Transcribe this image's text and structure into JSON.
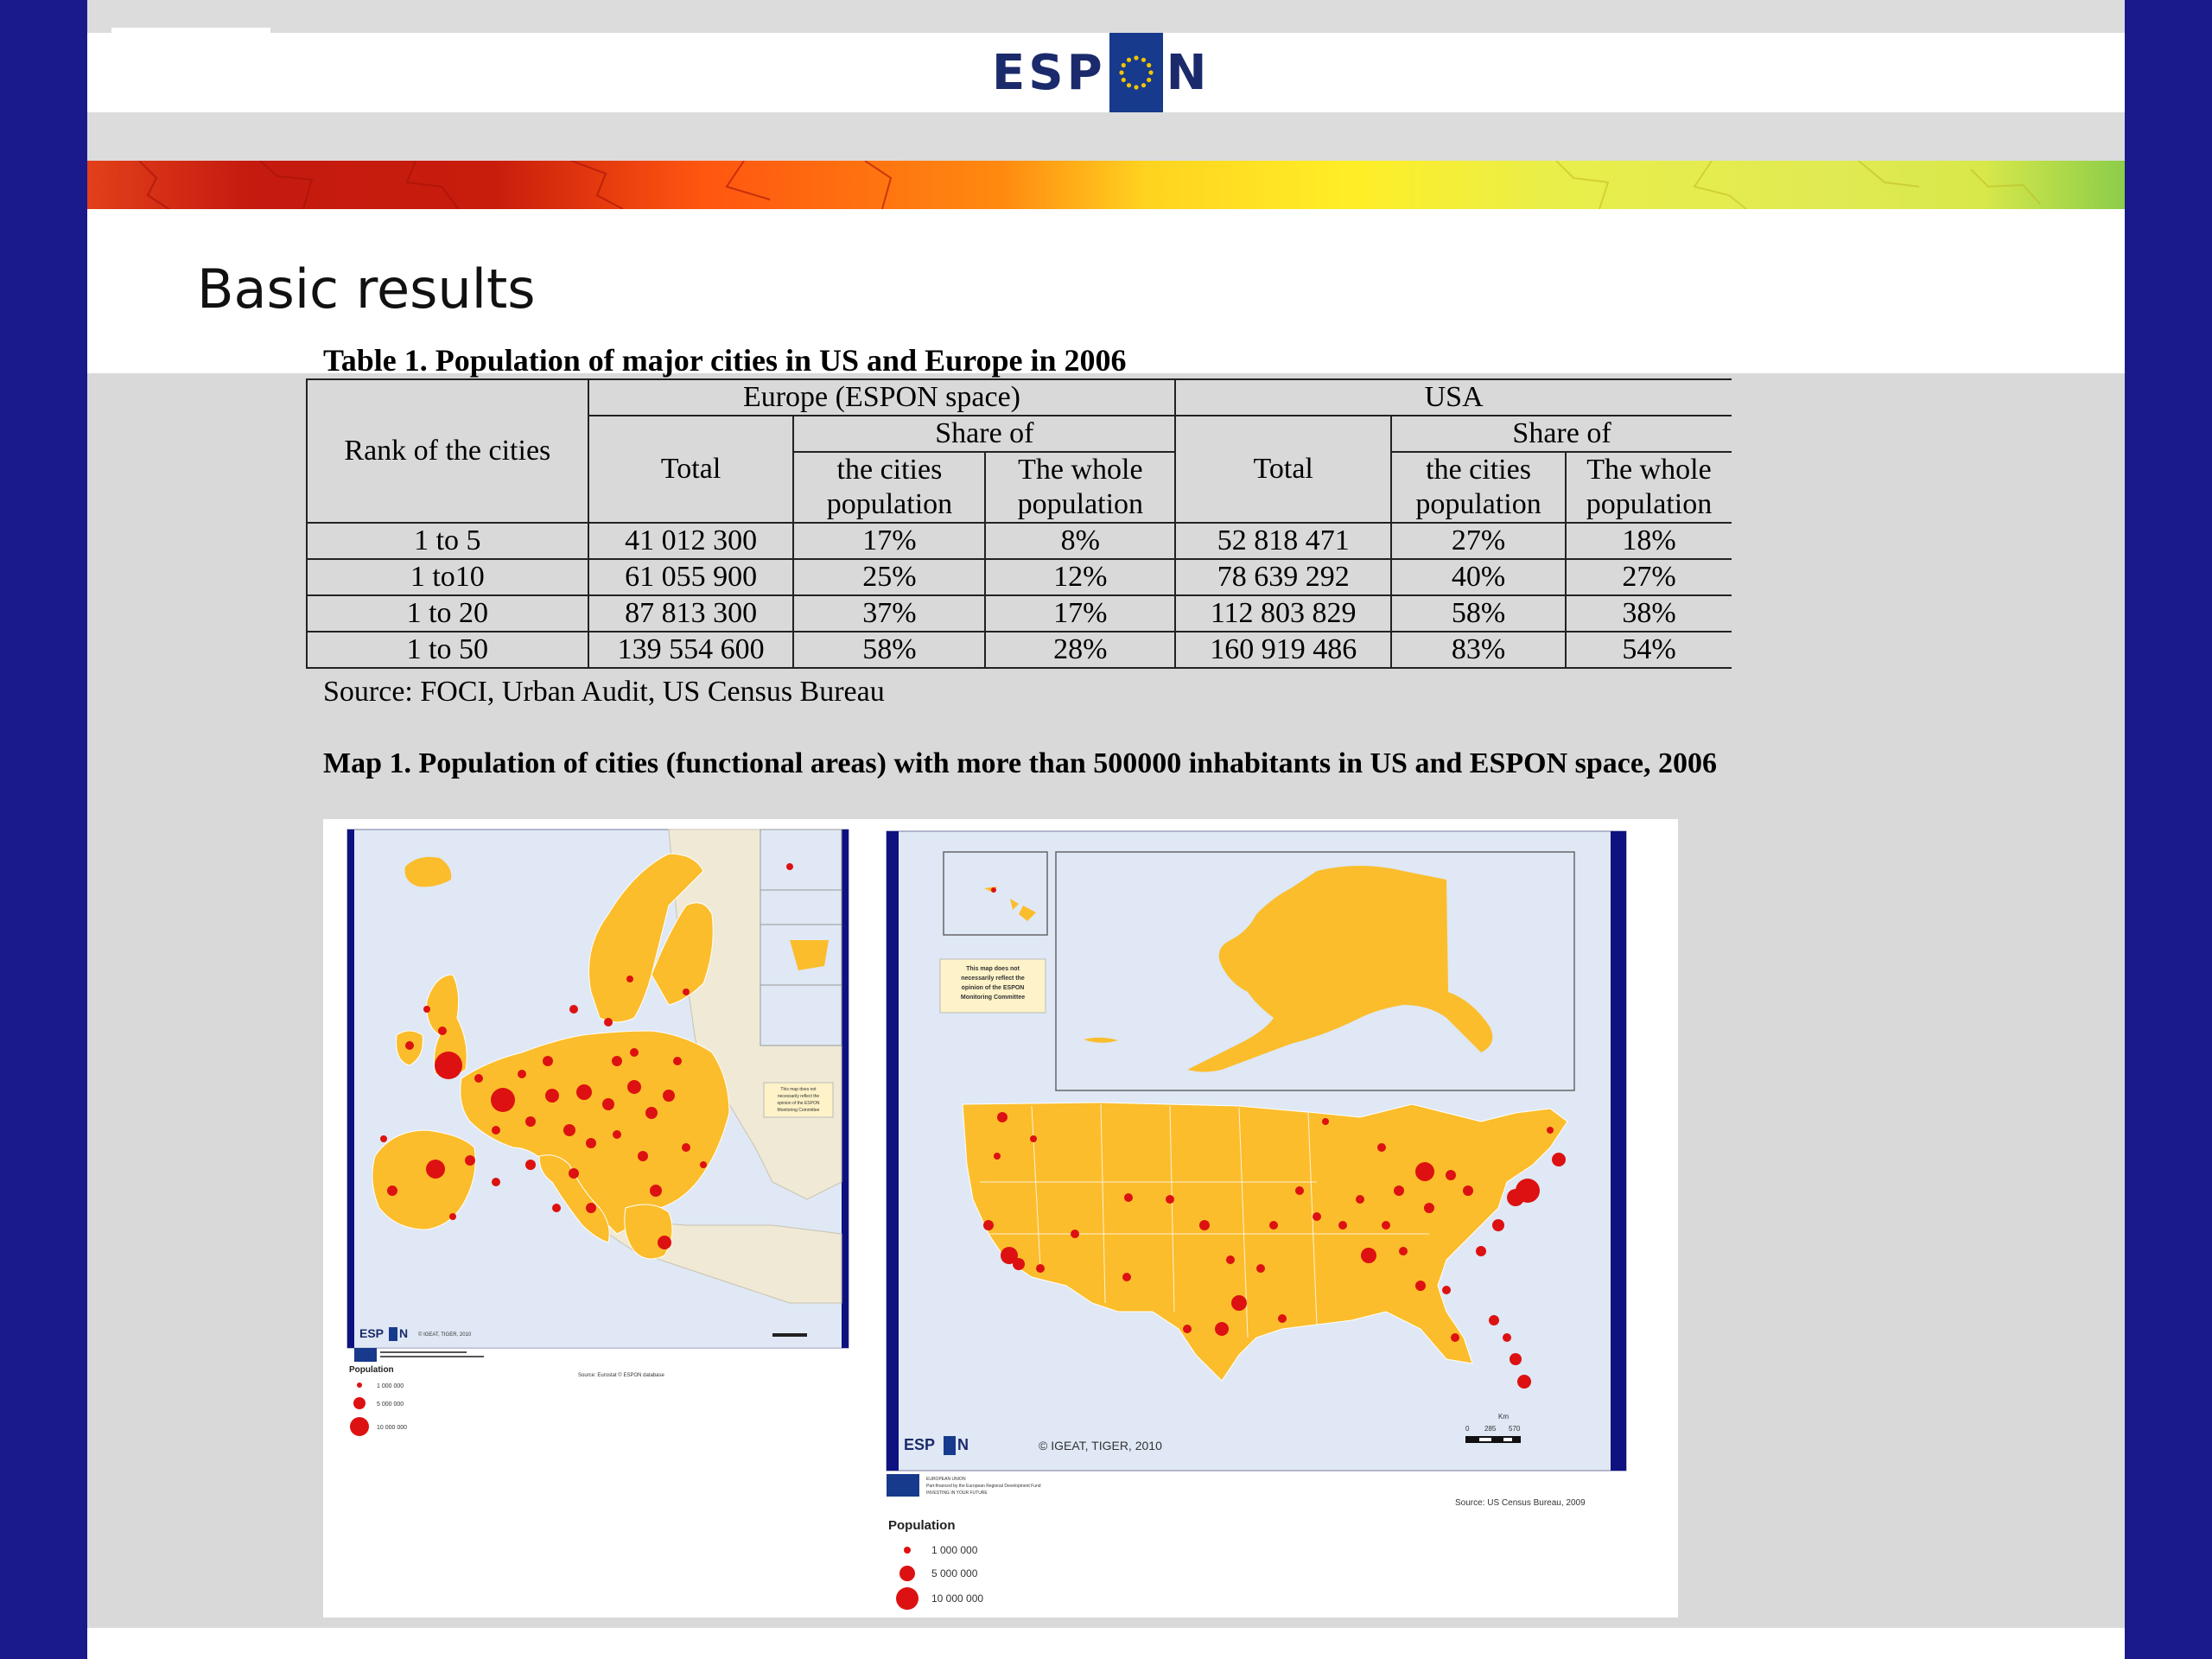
{
  "header": {
    "logo_left": "ESP",
    "logo_right": "N"
  },
  "slide": {
    "title": "Basic results"
  },
  "table": {
    "caption": "Table 1. Population of major cities in US and Europe in 2006",
    "headers": {
      "rank": "Rank of the cities",
      "europe": "Europe (ESPON space)",
      "usa": "USA",
      "total": "Total",
      "share_of": "Share of",
      "cities_population": "the cities population",
      "whole_population": "The whole population"
    },
    "rows": [
      [
        "1 to 5",
        "41 012 300",
        "17%",
        "8%",
        "52 818 471",
        "27%",
        "18%"
      ],
      [
        "1 to10",
        "61 055 900",
        "25%",
        "12%",
        "78 639 292",
        "40%",
        "27%"
      ],
      [
        "1 to 20",
        "87 813 300",
        "37%",
        "17%",
        "112 803 829",
        "58%",
        "38%"
      ],
      [
        "1 to 50",
        "139 554 600",
        "58%",
        "28%",
        "160 919 486",
        "83%",
        "54%"
      ]
    ],
    "source": "Source: FOCI, Urban Audit, US Census Bureau"
  },
  "map": {
    "caption": "Map 1. Population of cities (functional areas) with more than 500000 inhabitants in US and ESPON space, 2006",
    "europe": {
      "copyright": "© IGEAT, TIGER, 2010",
      "legend_title": "Population",
      "legend_values": [
        "1 000 000",
        "5 000 000",
        "10 000 000"
      ],
      "source": "Source: Eurostat © ESPON database",
      "disclaimer": [
        "This map does not",
        "necessarily reflect the",
        "opinion of the ESPON",
        "Monitoring Committee"
      ]
    },
    "usa": {
      "copyright": "© IGEAT, TIGER, 2010",
      "disclaimer": [
        "This map does not",
        "necessarily reflect the",
        "opinion of the ESPON",
        "Monitoring Committee"
      ],
      "scale_unit": "Km",
      "scale_ticks": [
        "0",
        "285",
        "570"
      ],
      "legend_title": "Population",
      "legend_values": [
        "1 000 000",
        "5 000 000",
        "10 000 000"
      ],
      "source": "Source: US Census Bureau, 2009",
      "eu_text": [
        "EUROPEAN UNION",
        "Part-financed by the European Regional Development Fund",
        "INVESTING IN YOUR FUTURE"
      ]
    },
    "logo_left": "ESP",
    "logo_right": "N"
  },
  "colors": {
    "frame": "#1a1a8c",
    "land": "#fbbd2c",
    "city": "#dd1111",
    "sea": "#dfe8f4"
  }
}
